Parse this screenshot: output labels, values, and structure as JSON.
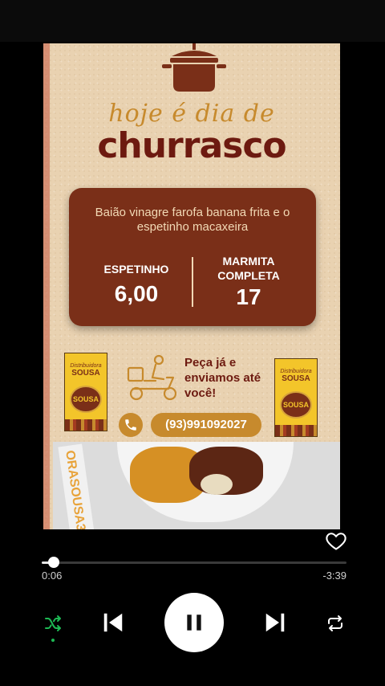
{
  "video": {
    "heading_script": "hoje é dia de",
    "heading_main": "churrasco",
    "menu": {
      "description": "Baião vinagre farofa banana frita e o espetinho  macaxeira",
      "item1_label": "ESPETINHO",
      "item1_price": "6,00",
      "item2_label": "MARMITA COMPLETA",
      "item2_price": "17"
    },
    "order_text": "Peça já e enviamos até você!",
    "phone": "(93)991092027",
    "brand_top": "Distribuidora",
    "brand_name": "SOUSA",
    "badge_text": "SOUSA",
    "photo_label": "ORASOUSA3"
  },
  "player": {
    "elapsed": "0:06",
    "remaining": "-3:39",
    "progress_fraction": 0.039
  },
  "icons": [
    "heart-icon",
    "shuffle-icon",
    "previous-icon",
    "pause-icon",
    "next-icon",
    "repeat-icon",
    "pot-icon",
    "delivery-scooter-icon",
    "phone-icon"
  ],
  "colors": {
    "accent_brown": "#7a2f18",
    "heading_red": "#6d1a10",
    "gold": "#c78a2d",
    "shuffle_active": "#1db954"
  }
}
